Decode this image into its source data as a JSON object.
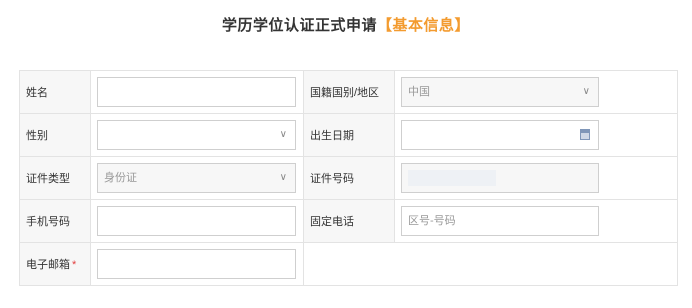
{
  "title": {
    "main": "学历学位认证正式申请",
    "section": "【基本信息】"
  },
  "form": {
    "name_label": "姓名",
    "nationality_label": "国籍国别/地区",
    "nationality_value": "中国",
    "gender_label": "性别",
    "birthdate_label": "出生日期",
    "id_type_label": "证件类型",
    "id_type_value": "身份证",
    "id_number_label": "证件号码",
    "mobile_label": "手机号码",
    "landline_label": "固定电话",
    "landline_placeholder": "区号-号码",
    "email_label": "电子邮箱",
    "required_mark": "*"
  },
  "icons": {
    "dropdown": "chevron-down-icon",
    "calendar": "calendar-icon"
  },
  "colors": {
    "accent": "#f39b2f",
    "required": "#e23d3d"
  }
}
